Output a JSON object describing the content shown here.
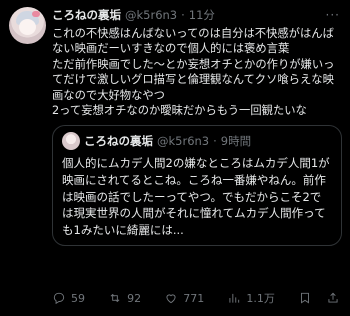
{
  "tweet": {
    "author_name": "ころねの裏垢",
    "handle": "@k5r6n3",
    "time_sep": "·",
    "time": "11分",
    "text": "これの不快感はんばないってのは自分は不快感がはんばない映画だーいすきなので個人的には褒め言葉\nただ前作映画でした〜とか妄想オチとかの作りが嫌いってだけで激しいグロ描写と倫理観なんてクソ喰らえな映画なので大好物なやつ\n2って妄想オチなのか曖昧だからもう一回観たいな"
  },
  "quote": {
    "author_name": "ころねの裏垢",
    "handle": "@k5r6n3",
    "time_sep": "·",
    "time": "9時間",
    "text": "個人的にムカデ人間2の嫌なところはムカデ人間1が映画にされてるとこね。ころね一番嫌やねん。前作は映画の話でしたーってやつ。でもだからこそ2では現実世界の人間がそれに憧れてムカデ人間作っても1みたいに綺麗には..."
  },
  "actions": {
    "replies": "59",
    "reposts": "92",
    "likes": "771",
    "views": "1.1万"
  },
  "icons": [
    "more-icon",
    "reply-icon",
    "repost-icon",
    "like-icon",
    "views-icon",
    "bookmark-icon",
    "share-icon"
  ]
}
